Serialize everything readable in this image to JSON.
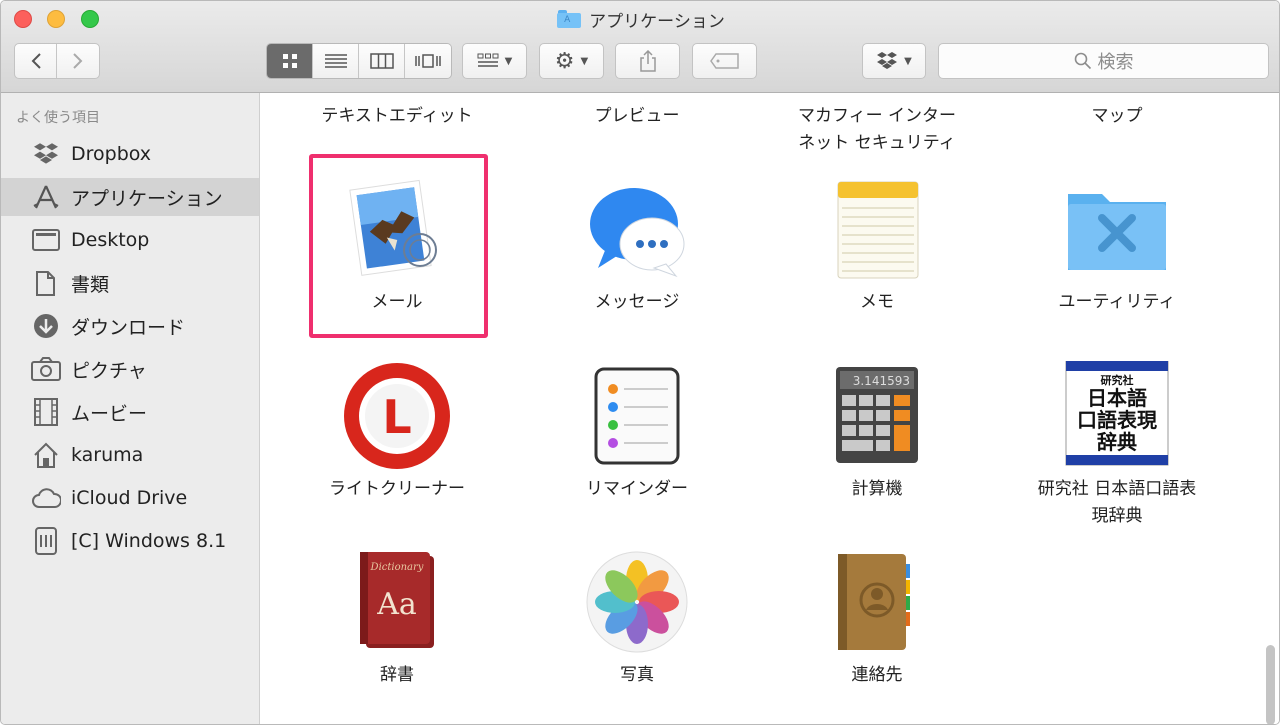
{
  "window": {
    "title": "アプリケーション",
    "folder_glyph": "A"
  },
  "toolbar": {
    "back_icon": "chevron-left-icon",
    "forward_icon": "chevron-right-icon",
    "view_modes": [
      "icon-view",
      "list-view",
      "column-view",
      "cover-flow-view"
    ],
    "active_view": "icon-view",
    "search_placeholder": "検索"
  },
  "sidebar": {
    "heading": "よく使う項目",
    "items": [
      {
        "label": "Dropbox",
        "icon": "dropbox-icon"
      },
      {
        "label": "アプリケーション",
        "icon": "applications-icon",
        "selected": true
      },
      {
        "label": "Desktop",
        "icon": "desktop-icon"
      },
      {
        "label": "書類",
        "icon": "documents-icon"
      },
      {
        "label": "ダウンロード",
        "icon": "download-icon"
      },
      {
        "label": "ピクチャ",
        "icon": "camera-icon"
      },
      {
        "label": "ムービー",
        "icon": "film-icon"
      },
      {
        "label": "karuma",
        "icon": "home-icon"
      },
      {
        "label": "iCloud Drive",
        "icon": "cloud-icon"
      },
      {
        "label": "[C] Windows 8.1",
        "icon": "drive-icon"
      }
    ]
  },
  "top_row": [
    "テキストエディット",
    "プレビュー",
    "マカフィー インター",
    "ネット セキュリティ",
    "マップ"
  ],
  "apps": [
    {
      "label": "メール",
      "icon": "mail-icon",
      "highlighted": true
    },
    {
      "label": "メッセージ",
      "icon": "messages-icon"
    },
    {
      "label": "メモ",
      "icon": "notes-icon"
    },
    {
      "label": "ユーティリティ",
      "icon": "utilities-folder-icon"
    },
    {
      "label": "ライトクリーナー",
      "icon": "lite-cleaner-icon"
    },
    {
      "label": "リマインダー",
      "icon": "reminders-icon"
    },
    {
      "label": "計算機",
      "icon": "calculator-icon"
    },
    {
      "label_line1": "研究社 日本語口語表",
      "label_line2": "現辞典",
      "icon": "dictionary-book-icon"
    },
    {
      "label": "辞書",
      "icon": "dictionary-icon"
    },
    {
      "label": "写真",
      "icon": "photos-icon"
    },
    {
      "label": "連絡先",
      "icon": "contacts-icon"
    }
  ],
  "icon_text": {
    "calc_display": "3.141593",
    "kenkyusha_top": "研究社",
    "kenkyusha_l1": "日本語",
    "kenkyusha_l2": "口語表現",
    "kenkyusha_l3": "辞典",
    "dictionary_word": "Dictionary",
    "dictionary_aa": "Aa",
    "lite_letter": "L"
  },
  "colors": {
    "highlight": "#ef2f6e",
    "sidebar_bg": "#ececec",
    "selected_row": "#d3d3d3"
  }
}
